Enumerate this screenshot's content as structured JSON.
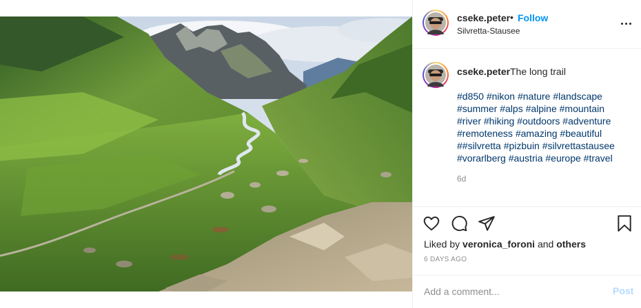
{
  "header": {
    "username": "cseke.peter",
    "separator": "•",
    "follow_label": "Follow",
    "location": "Silvretta-Stausee",
    "more_icon": "more-horizontal-icon"
  },
  "photo": {
    "subject": "photo"
  },
  "caption": {
    "username": "cseke.peter",
    "text": "The long trail",
    "hashtag_lines": [
      "#d850 #nikon #nature #landscape",
      "#summer #alps #alpine #mountain",
      "#river #hiking #outdoors #adventure",
      "#remoteness #amazing #beautiful",
      "##silvretta #pizbuin #silvrettastausee",
      "#vorarlberg #austria #europe #travel"
    ],
    "time_ago": "6d"
  },
  "actions": {
    "icons": [
      "heart-icon",
      "comment-icon",
      "share-icon",
      "bookmark-icon"
    ],
    "liked_prefix": "Liked by",
    "liked_user": "veronica_foroni",
    "liked_and": "and",
    "liked_others": "others",
    "date": "6 DAYS AGO"
  },
  "comment": {
    "placeholder": "Add a comment...",
    "post_label": "Post"
  },
  "colors": {
    "link_blue": "#0095f6",
    "hashtag": "#00376b",
    "muted": "#8e8e8e",
    "post_disabled": "#b3dbff"
  }
}
